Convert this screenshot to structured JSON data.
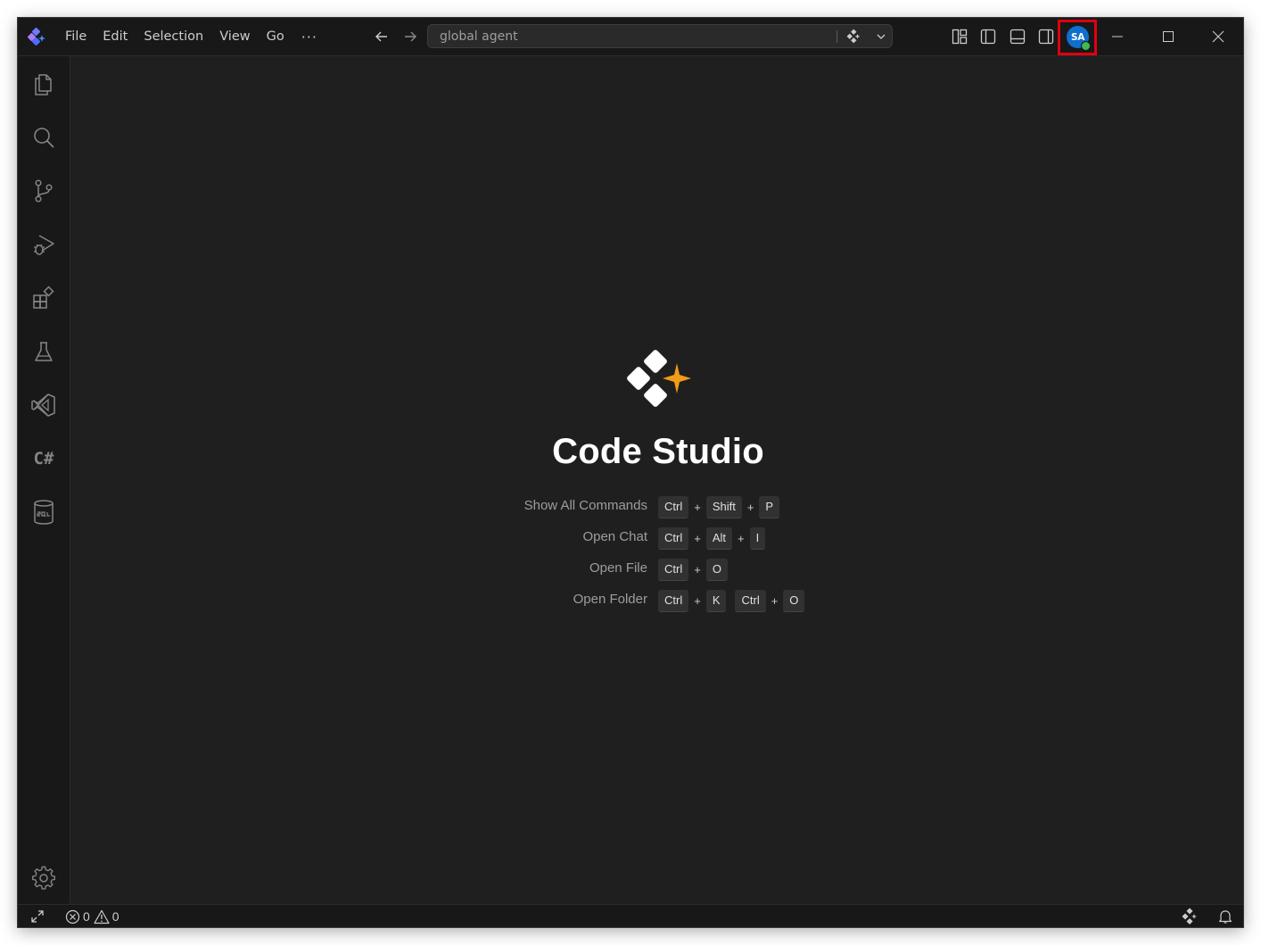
{
  "titlebar": {
    "menu": [
      "File",
      "Edit",
      "Selection",
      "View",
      "Go"
    ],
    "more_label": "···",
    "search_text": "global agent",
    "account_initials": "SA"
  },
  "activity_bar": {
    "items": [
      "explorer",
      "search",
      "source-control",
      "run-and-debug",
      "extensions",
      "testing",
      "visual-studio",
      "csharp",
      "sql"
    ],
    "csharp_label": "C#"
  },
  "welcome": {
    "title": "Code Studio",
    "shortcuts": [
      {
        "label": "Show All Commands",
        "keys": [
          "Ctrl",
          "Shift",
          "P"
        ]
      },
      {
        "label": "Open Chat",
        "keys": [
          "Ctrl",
          "Alt",
          "I"
        ]
      },
      {
        "label": "Open File",
        "keys": [
          "Ctrl",
          "O"
        ]
      },
      {
        "label": "Open Folder",
        "keys": [
          "Ctrl",
          "K"
        ],
        "keys2": [
          "Ctrl",
          "O"
        ]
      }
    ]
  },
  "statusbar": {
    "errors": "0",
    "warnings": "0"
  },
  "colors": {
    "accent_orange": "#f29b19",
    "avatar_blue": "#0e6fcd",
    "highlight_red": "#e0000f",
    "presence_green": "#3fb950"
  }
}
